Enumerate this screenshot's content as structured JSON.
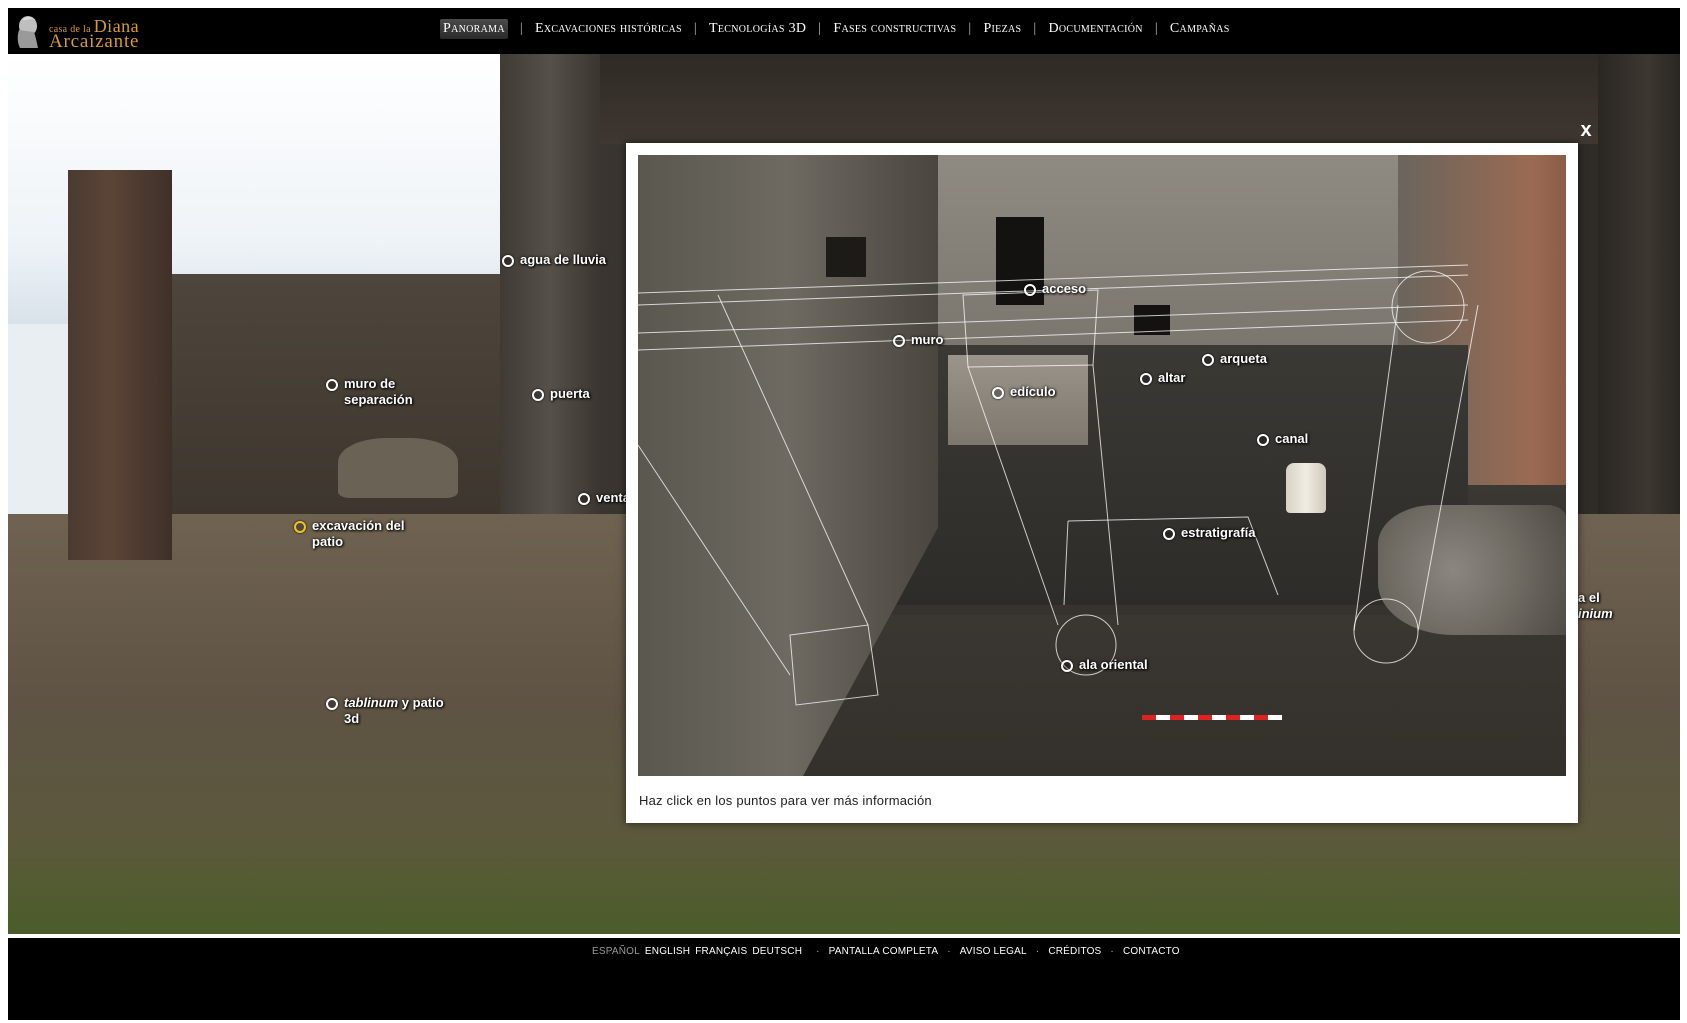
{
  "logo": {
    "line1_small": "casa de la",
    "line1_big": "Diana",
    "line2": "Arcaizante"
  },
  "nav": [
    {
      "label": "Panorama",
      "active": true
    },
    {
      "label": "Excavaciones históricas",
      "active": false
    },
    {
      "label": "Tecnologías 3D",
      "active": false
    },
    {
      "label": "Fases constructivas",
      "active": false
    },
    {
      "label": "Piezas",
      "active": false
    },
    {
      "label": "Documentación",
      "active": false
    },
    {
      "label": "Campañas",
      "active": false
    }
  ],
  "nav_separator": "|",
  "panorama_hotspots": {
    "agua": "agua de lluvia",
    "muro_line1": "muro de",
    "muro_line2": "separación",
    "puerta": "puerta",
    "ventana": "venta",
    "excavacion_line1": "excavación del",
    "excavacion_line2": "patio",
    "tablinum_italic": "tablinum",
    "tablinum_rest": " y patio",
    "tablinum_line2": "3d",
    "edge_line1": "a el",
    "edge_line2": "inium"
  },
  "modal": {
    "close": "x",
    "caption": "Haz click en los puntos para ver más información",
    "hotspots": {
      "acceso": "acceso",
      "muro": "muro",
      "arqueta": "arqueta",
      "edicula": "edículo",
      "altar": "altar",
      "canal": "canal",
      "estratigrafia": "estratigrafía",
      "ala_oriental": "ala oriental"
    }
  },
  "footer": {
    "languages": [
      {
        "label": "ESPAÑOL",
        "current": true
      },
      {
        "label": "ENGLISH",
        "current": false
      },
      {
        "label": "FRANÇAIS",
        "current": false
      },
      {
        "label": "DEUTSCH",
        "current": false
      }
    ],
    "separator": "·",
    "links": [
      "PANTALLA COMPLETA",
      "AVISO LEGAL",
      "CRÉDITOS",
      "CONTACTO"
    ]
  },
  "colors": {
    "accent_gold": "#d49b3a",
    "hotspot_active": "#f2c31b",
    "background": "#000000"
  }
}
